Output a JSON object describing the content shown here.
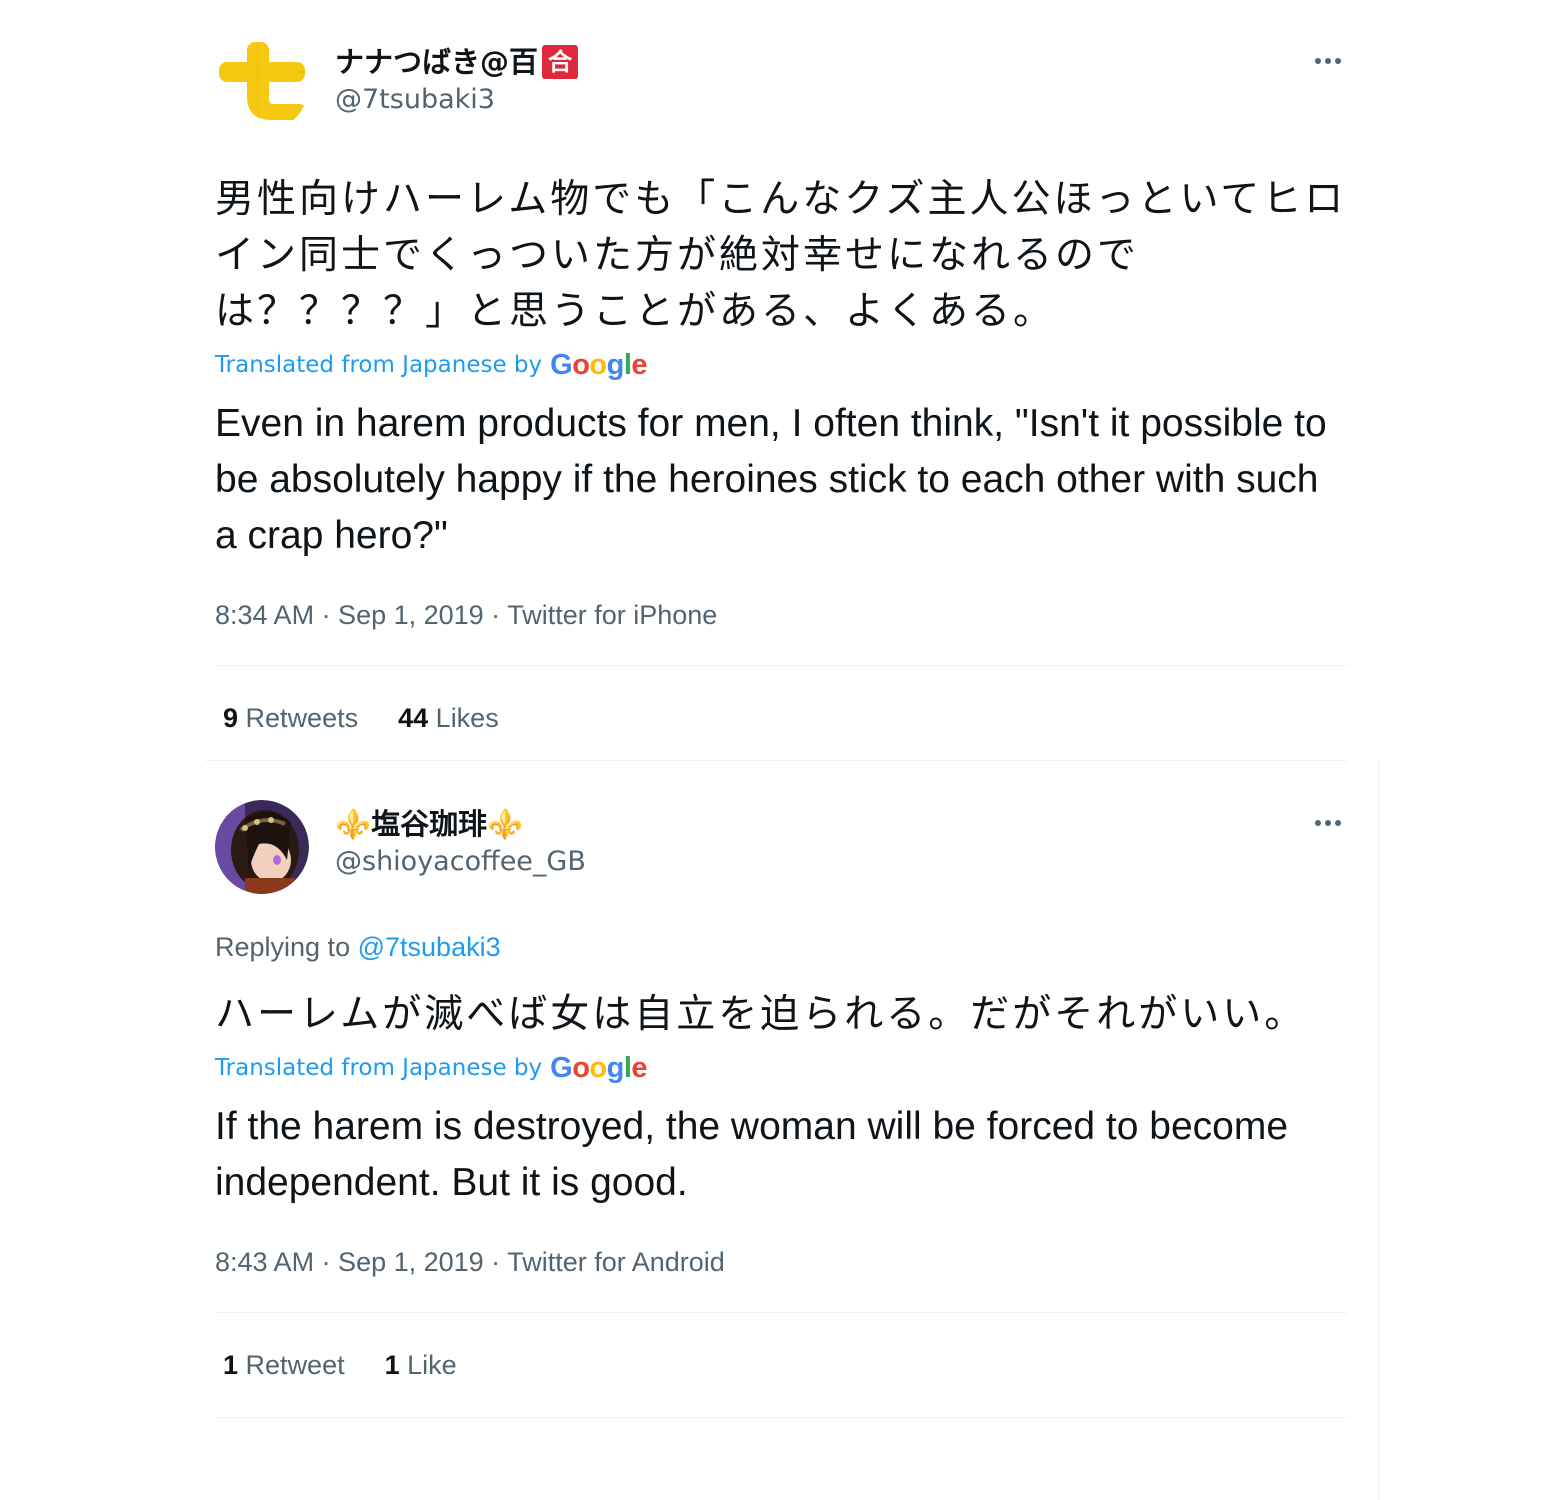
{
  "tweets": [
    {
      "display_name": "ナナつばき@百",
      "badge": "合",
      "handle": "@7tsubaki3",
      "text_ja": "男性向けハーレム物でも「こんなクズ主人公ほっといてヒロイン同士でくっついた方が絶対幸せになれるのでは？？？？」と思うことがある、よくある。",
      "translated_label": "Translated from Japanese by",
      "google_label": "Google",
      "text_en": "Even in harem products for men, I often think, \"Isn't it possible to be absolutely happy if the heroines stick to each other with such a crap hero?\"",
      "meta": "8:34 AM · Sep 1, 2019 · Twitter for iPhone",
      "stats": {
        "retweets_count": "9",
        "retweets_label": "Retweets",
        "likes_count": "44",
        "likes_label": "Likes"
      }
    },
    {
      "display_name": "⚜️塩谷珈琲⚜️",
      "handle": "@shioyacoffee_GB",
      "replying_prefix": "Replying to",
      "replying_handle": "@7tsubaki3",
      "text_ja": "ハーレムが滅べば女は自立を迫られる。だがそれがいい。",
      "translated_label": "Translated from Japanese by",
      "google_label": "Google",
      "text_en": "If the harem is destroyed, the woman will be forced to become independent. But it is good.",
      "meta": "8:43 AM · Sep 1, 2019 · Twitter for Android",
      "stats": {
        "retweets_count": "1",
        "retweets_label": "Retweet",
        "likes_count": "1",
        "likes_label": "Like"
      }
    }
  ],
  "colors": {
    "link": "#1d9bf0",
    "secondary": "#536471",
    "primary": "#0f1419",
    "badge": "#e0283d",
    "google_blue": "#4285f4",
    "google_red": "#ea4335",
    "google_yellow": "#fbbc05",
    "google_green": "#34a853"
  },
  "icons": {
    "more": "more-horizontal-icon",
    "avatar_1": "yellow-katakana-avatar",
    "avatar_2": "anime-character-avatar"
  }
}
